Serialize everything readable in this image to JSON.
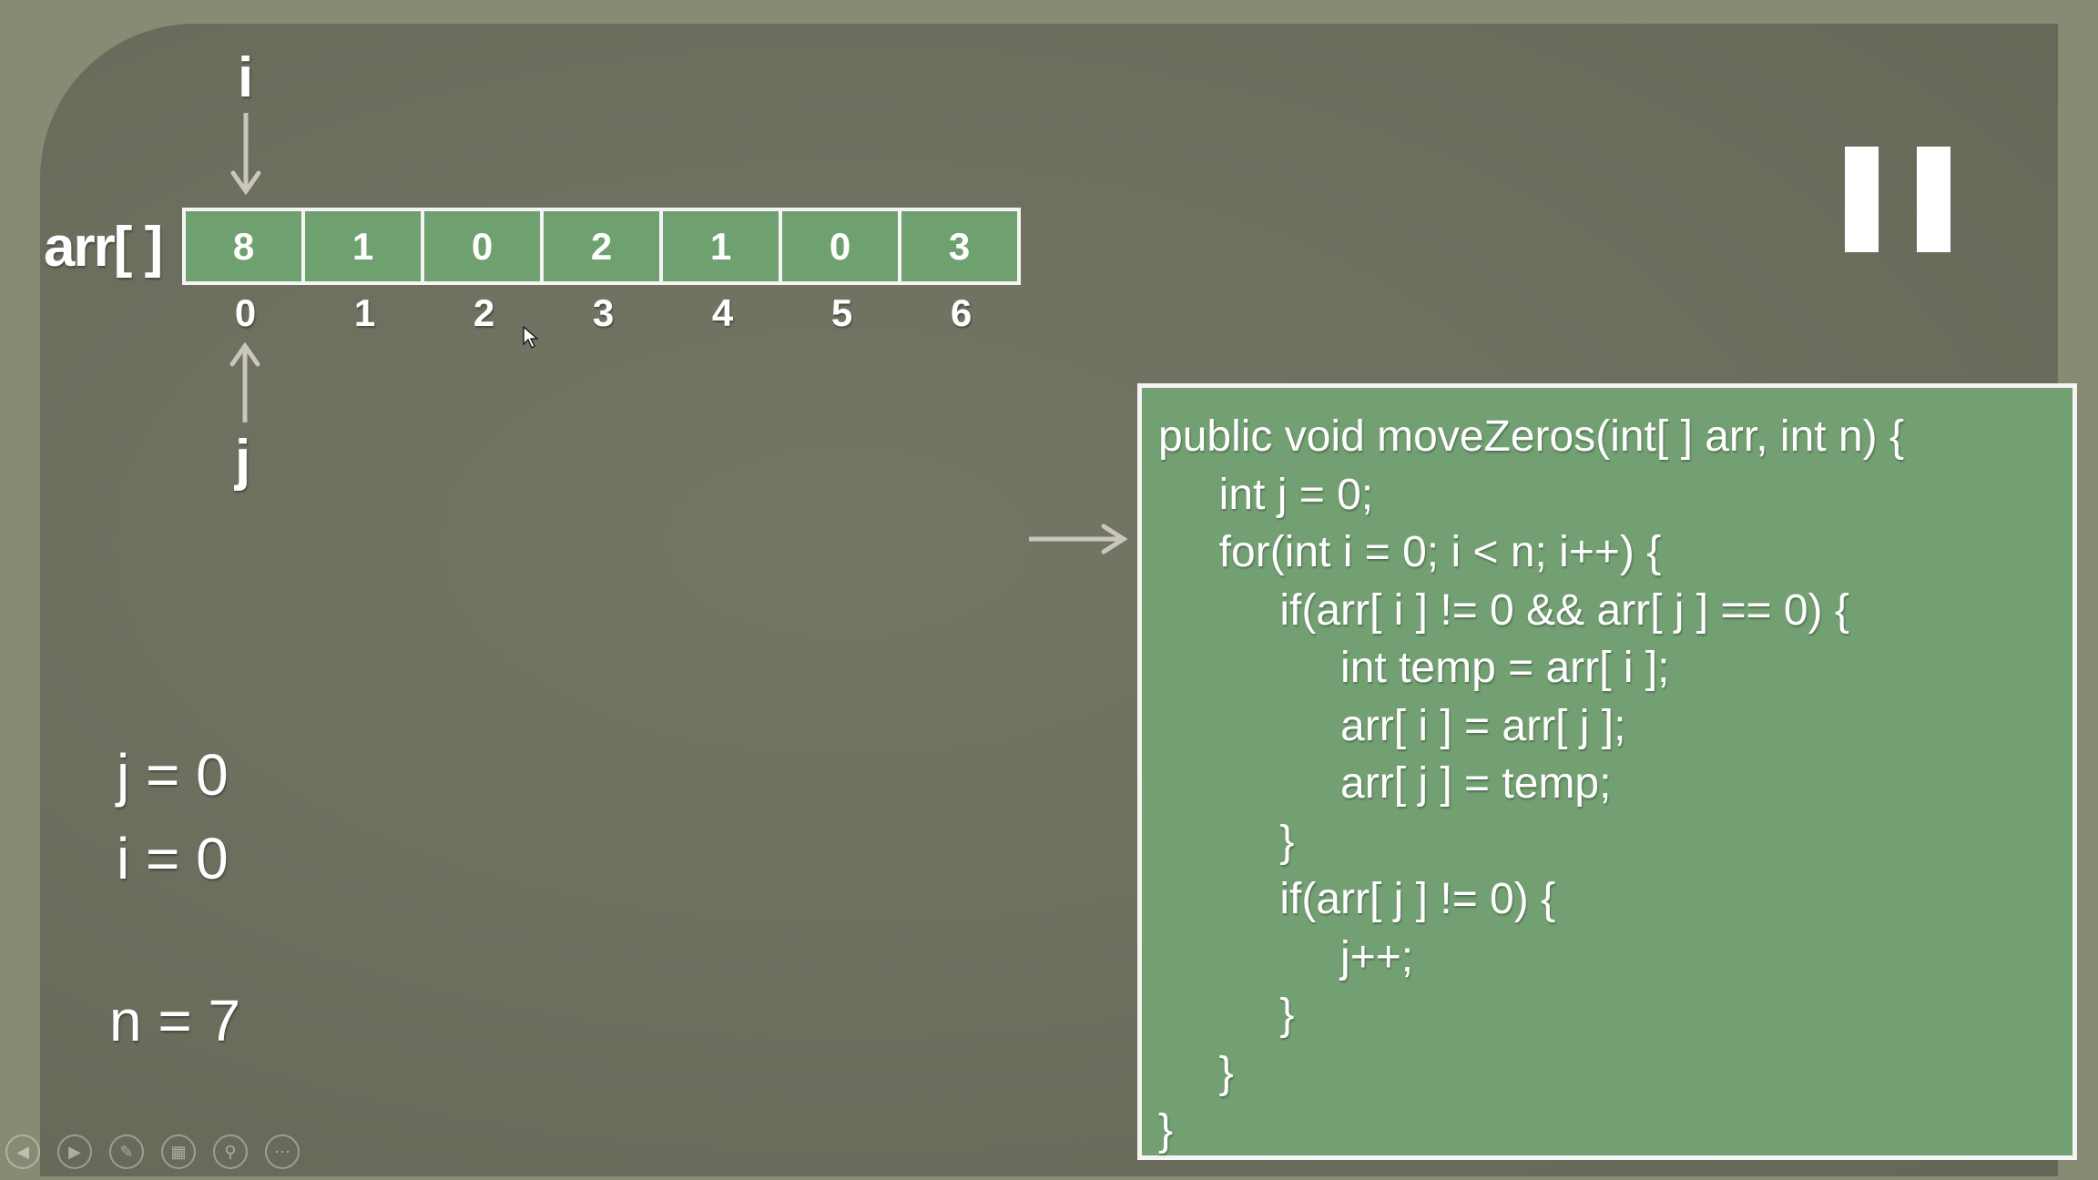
{
  "pointers": {
    "i_label": "i",
    "j_label": "j"
  },
  "array": {
    "label": "arr[ ]",
    "values": [
      "8",
      "1",
      "0",
      "2",
      "1",
      "0",
      "3"
    ],
    "indices": [
      "0",
      "1",
      "2",
      "3",
      "4",
      "5",
      "6"
    ]
  },
  "variables": {
    "j": "j = 0",
    "i": "i = 0",
    "n": "n = 7"
  },
  "code": {
    "lines": [
      "public void moveZeros(int[ ] arr, int n) {",
      "     int j = 0;",
      "     for(int i = 0; i < n; i++) {",
      "          if(arr[ i ] != 0 && arr[ j ] == 0) {",
      "               int temp = arr[ i ];",
      "               arr[ i ] = arr[ j ];",
      "               arr[ j ] = temp;",
      "          }",
      "          if(arr[ j ] != 0) {",
      "               j++;",
      "          }",
      "     }",
      "}"
    ]
  },
  "colors": {
    "background": "#6d6f5e",
    "frame": "#878b74",
    "cell_fill": "#6fa06f",
    "code_fill": "#73a073",
    "arrow": "#c9c7bb"
  },
  "icons": {
    "pause": "pause-icon",
    "controls": [
      "previous-icon",
      "next-icon",
      "pen-icon",
      "slides-icon",
      "zoom-icon",
      "more-icon"
    ]
  }
}
